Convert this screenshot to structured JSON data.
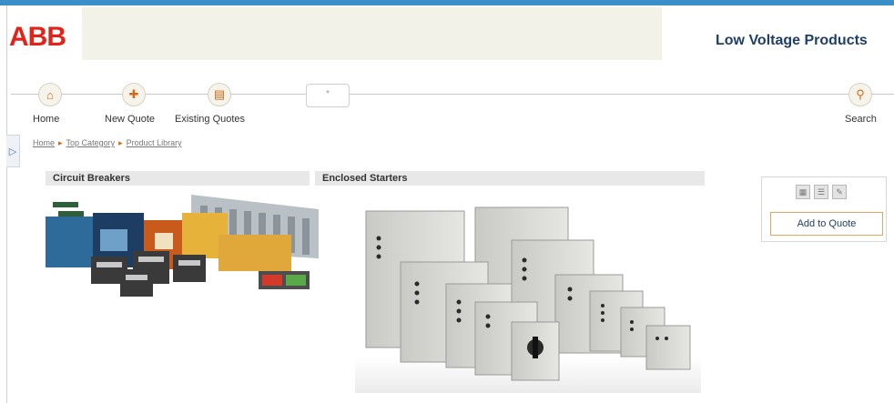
{
  "header": {
    "logo_text": "ABB",
    "product_title": "Low Voltage Products"
  },
  "nav": {
    "home_label": "Home",
    "new_quote_label": "New Quote",
    "existing_quotes_label": "Existing Quotes",
    "search_label": "Search",
    "tab_placeholder": "*"
  },
  "breadcrumb": {
    "items": [
      "Home",
      "Top Category",
      "Product Library"
    ]
  },
  "categories": {
    "circuit_breakers": "Circuit Breakers",
    "enclosed_starters": "Enclosed Starters"
  },
  "actions": {
    "add_to_quote": "Add to Quote"
  },
  "colors": {
    "brand_red": "#e2231a",
    "accent_orange": "#d06a1a",
    "title_blue": "#1e3f66"
  }
}
